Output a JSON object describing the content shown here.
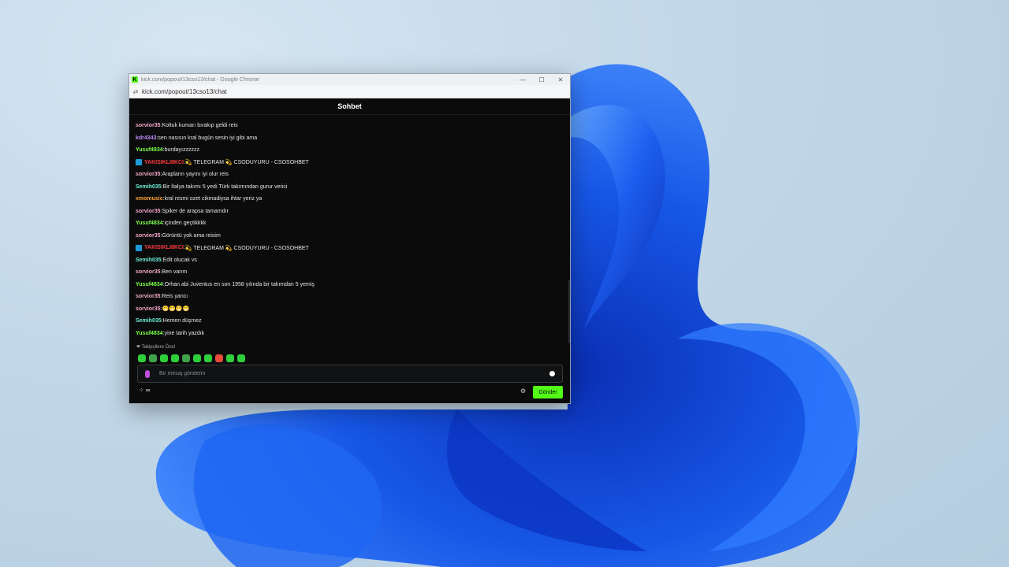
{
  "browser": {
    "title": "kick.com/popout/13cso13/chat - Google Chrome",
    "url": "kick.com/popout/13cso13/chat",
    "favicon_letter": "K"
  },
  "chat": {
    "header": "Sohbet",
    "messages": [
      {
        "user": "sorvior35",
        "color": "#f2a9c8",
        "text": "Koltuk kumarı bırakıp geldi reis",
        "badge": false
      },
      {
        "user": "kdr4343",
        "color": "#c08bff",
        "text": "sen nasısın kral bugün sesin iyi gibi ama",
        "badge": false
      },
      {
        "user": "Yusuf4834",
        "color": "#7cff4a",
        "text": "burdayızzzzzz",
        "badge": false
      },
      {
        "user": "YAKISIKLI8KCI",
        "color": "#ff3b3b",
        "text": "💫 TELEGRAM 💫 CSODUYURU - CSOSOHBET",
        "badge": true
      },
      {
        "user": "sorvior35",
        "color": "#f2a9c8",
        "text": "Arapların yayını iyi olur reis",
        "badge": false
      },
      {
        "user": "Semih035",
        "color": "#6ef0d8",
        "text": "Bir İtalya takımı 5 yedi Türk takımından gurur verici",
        "badge": false
      },
      {
        "user": "xmomusic",
        "color": "#ffa23a",
        "text": "kral resmi ozet cikmadiysa ihtar yeriz ya",
        "badge": false
      },
      {
        "user": "sorvior35",
        "color": "#f2a9c8",
        "text": "Spiker de arapsa tamamdır",
        "badge": false
      },
      {
        "user": "Yusuf4834",
        "color": "#7cff4a",
        "text": "içinden geçtikkkk",
        "badge": false
      },
      {
        "user": "sorvior35",
        "color": "#f2a9c8",
        "text": "Görüntü yok ama reisim",
        "badge": false
      },
      {
        "user": "YAKISIKLI8KCI",
        "color": "#ff3b3b",
        "text": "💫 TELEGRAM 💫 CSODUYURU - CSOSOHBET",
        "badge": true
      },
      {
        "user": "Semih035",
        "color": "#6ef0d8",
        "text": "Edit olucak vs",
        "badge": false
      },
      {
        "user": "sorvior35",
        "color": "#f2a9c8",
        "text": "Ben varım",
        "badge": false
      },
      {
        "user": "Yusuf4834",
        "color": "#7cff4a",
        "text": "Orhan abi Juventus en son 1958 yılında bir takımdan 5 yemiş",
        "badge": false
      },
      {
        "user": "sorvior35",
        "color": "#f2a9c8",
        "text": "Reis yancı",
        "badge": false
      },
      {
        "user": "sorvior35",
        "color": "#f2a9c8",
        "text": "😁😁😁😁",
        "badge": false
      },
      {
        "user": "Semih035",
        "color": "#6ef0d8",
        "text": "Hemen düşmez",
        "badge": false
      },
      {
        "user": "Yusuf4834",
        "color": "#7cff4a",
        "text": "yine tarih yazdık",
        "badge": false
      }
    ],
    "followers_label": "❤ Takipçilere Özel",
    "emote_count": 10,
    "input_placeholder": "Bir mesaj gönderin",
    "bottom_left_label": "∞",
    "send_label": "Gönder"
  },
  "colors": {
    "accent": "#53fc18",
    "chat_bg": "#0b0b0c"
  }
}
